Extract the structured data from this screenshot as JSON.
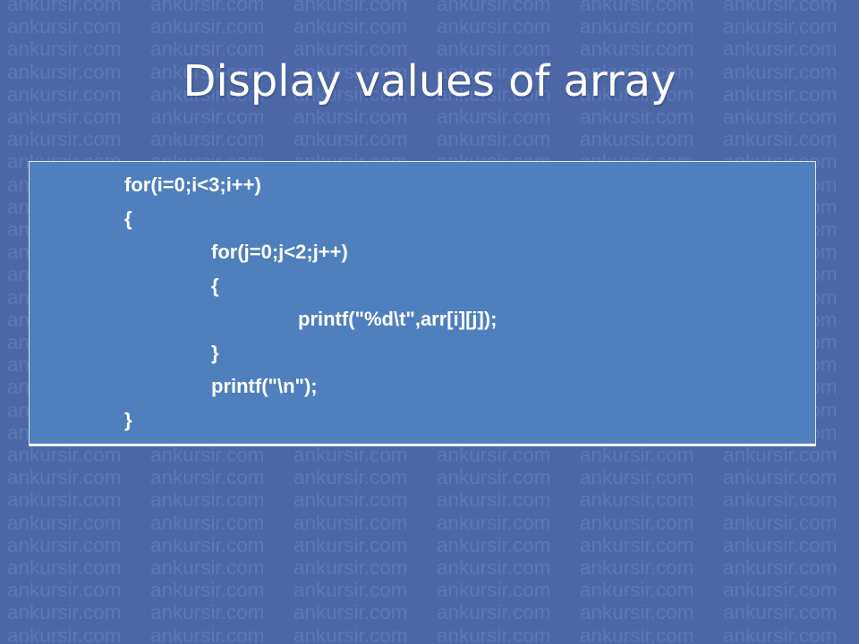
{
  "watermark": {
    "text": "ankursir.com"
  },
  "slide": {
    "title": "Display values of array"
  },
  "code": {
    "lines": [
      {
        "text": "for(i=0;i<3;i++)",
        "indent": 0
      },
      {
        "text": "{",
        "indent": 0
      },
      {
        "text": "for(j=0;j<2;j++)",
        "indent": 1
      },
      {
        "text": "{",
        "indent": 1
      },
      {
        "text": "printf(\"%d\\t\",arr[i][j]);",
        "indent": 2
      },
      {
        "text": "}",
        "indent": 1
      },
      {
        "text": "printf(\"\\n\");",
        "indent": 1
      },
      {
        "text": "}",
        "indent": 0
      }
    ]
  },
  "colors": {
    "background": "#4b67a5",
    "watermark": "#5b78b6",
    "code_box": "#4f80bd",
    "text": "#ffffff"
  }
}
